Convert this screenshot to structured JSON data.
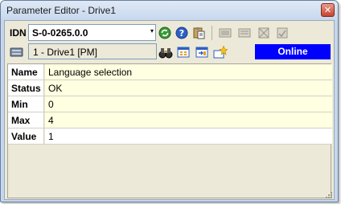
{
  "window": {
    "title": "Parameter Editor - Drive1",
    "close_glyph": "✕"
  },
  "toolbar": {
    "idn_label": "IDN",
    "idn_value": "S-0-0265.0.0",
    "combo_arrow": "▾",
    "icons": [
      "refresh-icon",
      "help-icon",
      "clipboard-paste-icon",
      "list-icon-1",
      "list-icon-2",
      "grid-icon-1",
      "grid-icon-2"
    ]
  },
  "drive": {
    "name": "1 - Drive1 [PM]",
    "status": "Online",
    "status_color": "#0000ff",
    "icons": [
      "binoculars-icon",
      "grid-view-icon",
      "import-icon",
      "star-burst-icon"
    ]
  },
  "parameters": [
    {
      "label": "Name",
      "value": "Language selection",
      "editable": false
    },
    {
      "label": "Status",
      "value": "OK",
      "editable": false
    },
    {
      "label": "Min",
      "value": "0",
      "editable": false
    },
    {
      "label": "Max",
      "value": "4",
      "editable": false
    },
    {
      "label": "Value",
      "value": "1",
      "editable": true
    }
  ]
}
